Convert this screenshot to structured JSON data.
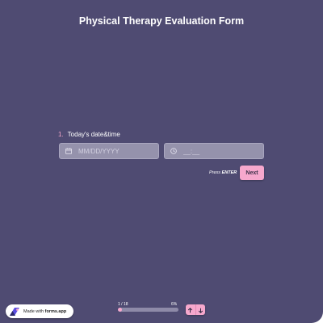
{
  "form": {
    "title": "Physical Therapy Evaluation Form"
  },
  "question": {
    "number": "1.",
    "label": "Today's date&time",
    "date_placeholder": "MM/DD/YYYY",
    "time_placeholder": "__:__"
  },
  "actions": {
    "hint_prefix": "Press",
    "hint_key": "ENTER",
    "next_label": "Next"
  },
  "footer": {
    "badge_prefix": "Made with",
    "badge_brand": "forms.app",
    "progress_count": "1 / 18",
    "progress_percent": "6%",
    "progress_value": 0.06
  },
  "icons": [
    "calendar-icon",
    "clock-icon",
    "forms-app-logo-icon",
    "arrow-up-icon",
    "arrow-down-icon"
  ],
  "colors": {
    "background": "#4f4b72",
    "accent": "#f6a8cd",
    "field": "#9592ac"
  }
}
